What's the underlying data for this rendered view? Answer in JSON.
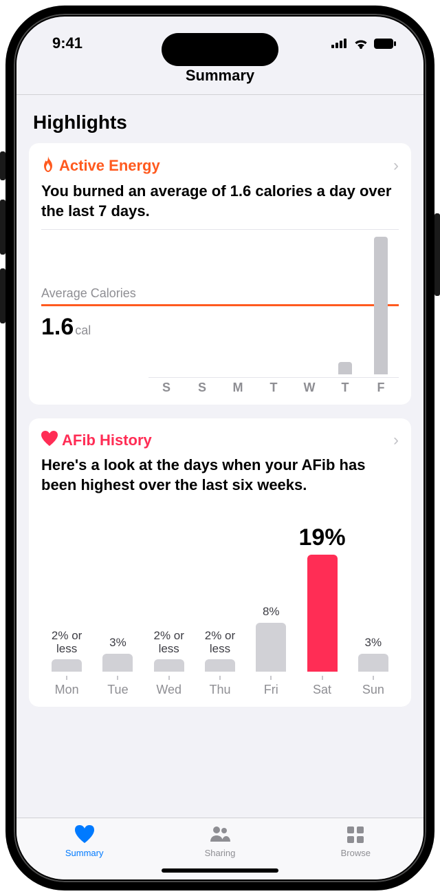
{
  "status": {
    "time": "9:41"
  },
  "nav": {
    "title": "Summary"
  },
  "section_title": "Highlights",
  "cards": {
    "active_energy": {
      "title": "Active Energy",
      "description": "You burned an average of 1.6 calories a day over the last 7 days.",
      "avg_label": "Average Calories",
      "value": "1.6",
      "unit": "cal"
    },
    "afib": {
      "title": "AFib History",
      "description": "Here's a look at the days when your AFib has been highest over the last six weeks."
    }
  },
  "chart_data": [
    {
      "type": "bar",
      "id": "active_energy",
      "title": "Active Energy — Average Calories",
      "ylabel": "cal",
      "average": 1.6,
      "categories": [
        "S",
        "S",
        "M",
        "T",
        "W",
        "T",
        "F"
      ],
      "values": [
        0,
        0,
        0,
        0,
        0,
        1,
        11
      ]
    },
    {
      "type": "bar",
      "id": "afib_history",
      "title": "AFib History — highest days over last six weeks",
      "ylabel": "%",
      "categories": [
        "Mon",
        "Tue",
        "Wed",
        "Thu",
        "Fri",
        "Sat",
        "Sun"
      ],
      "labels": [
        "2% or\nless",
        "3%",
        "2% or\nless",
        "2% or\nless",
        "8%",
        "19%",
        "3%"
      ],
      "values": [
        2,
        3,
        2,
        2,
        8,
        19,
        3
      ],
      "highlight_index": 5
    }
  ],
  "tabs": {
    "summary": "Summary",
    "sharing": "Sharing",
    "browse": "Browse"
  }
}
